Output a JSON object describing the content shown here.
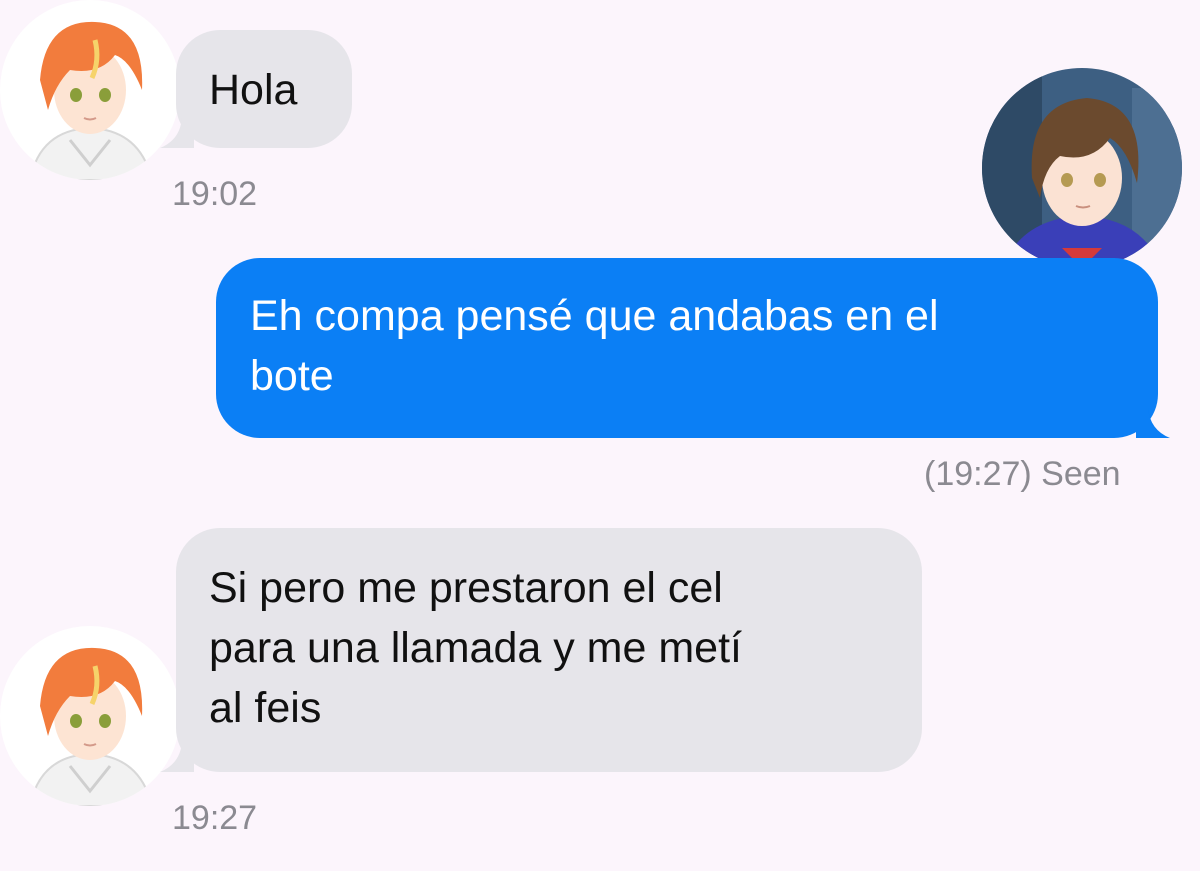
{
  "colors": {
    "background": "#fcf5fc",
    "incoming_bubble": "#e6e5ea",
    "outgoing_bubble": "#0b7ff5",
    "timestamp": "#8b8a91"
  },
  "contact": {
    "avatar_icon": "orange-haired-anime-character-avatar"
  },
  "self": {
    "avatar_icon": "brown-haired-anime-character-avatar"
  },
  "messages": [
    {
      "direction": "incoming",
      "text": "Hola",
      "time": "19:02"
    },
    {
      "direction": "outgoing",
      "text": "Eh compa pensé que andabas en el\nbote",
      "status": "(19:27) Seen"
    },
    {
      "direction": "incoming",
      "text": "Si pero me prestaron el cel\npara una llamada y me metí\nal feis",
      "time": "19:27"
    }
  ]
}
